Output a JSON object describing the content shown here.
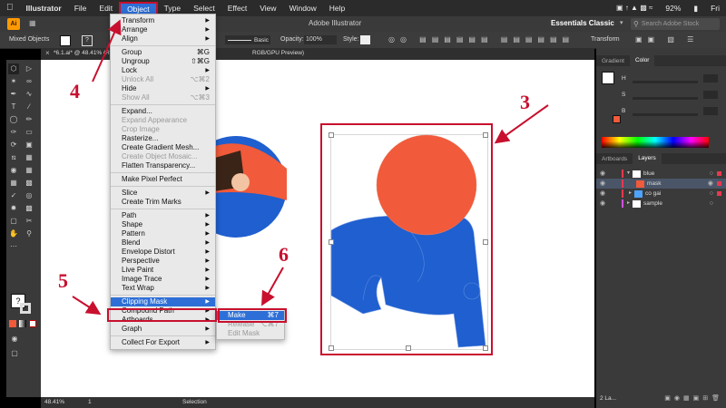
{
  "menubar": {
    "app_name": "Illustrator",
    "items": [
      "File",
      "Edit",
      "Object",
      "Type",
      "Select",
      "Effect",
      "View",
      "Window",
      "Help"
    ],
    "active_item": "Object",
    "battery": "92%",
    "day": "Fri"
  },
  "appbar": {
    "title": "Adobe Illustrator",
    "workspace": "Essentials Classic",
    "search_placeholder": "Search Adobe Stock"
  },
  "control_bar": {
    "selection_label": "Mixed Objects",
    "stroke_style": "Basic",
    "opacity_label": "Opacity:",
    "opacity_value": "100%",
    "style_label": "Style:",
    "transform_label": "Transform"
  },
  "document_tab": {
    "title": "*6.1.ai* @ 48.41% (RGB",
    "title_tail": "RGB/GPU Preview)"
  },
  "status_bar": {
    "zoom": "48.41%",
    "page": "1",
    "tool": "Selection"
  },
  "object_menu": {
    "groups": [
      [
        {
          "label": "Transform",
          "sub": true
        },
        {
          "label": "Arrange",
          "sub": true
        },
        {
          "label": "Align",
          "sub": true
        }
      ],
      [
        {
          "label": "Group",
          "shortcut": "⌘G"
        },
        {
          "label": "Ungroup",
          "shortcut": "⇧⌘G"
        },
        {
          "label": "Lock",
          "sub": true
        },
        {
          "label": "Unlock All",
          "shortcut": "⌥⌘2",
          "disabled": true
        },
        {
          "label": "Hide",
          "sub": true
        },
        {
          "label": "Show All",
          "shortcut": "⌥⌘3",
          "disabled": true
        }
      ],
      [
        {
          "label": "Expand..."
        },
        {
          "label": "Expand Appearance",
          "disabled": true
        },
        {
          "label": "Crop Image",
          "disabled": true
        },
        {
          "label": "Rasterize..."
        },
        {
          "label": "Create Gradient Mesh..."
        },
        {
          "label": "Create Object Mosaic...",
          "disabled": true
        },
        {
          "label": "Flatten Transparency..."
        }
      ],
      [
        {
          "label": "Make Pixel Perfect"
        }
      ],
      [
        {
          "label": "Slice",
          "sub": true
        },
        {
          "label": "Create Trim Marks"
        }
      ],
      [
        {
          "label": "Path",
          "sub": true
        },
        {
          "label": "Shape",
          "sub": true
        },
        {
          "label": "Pattern",
          "sub": true
        },
        {
          "label": "Blend",
          "sub": true
        },
        {
          "label": "Envelope Distort",
          "sub": true
        },
        {
          "label": "Perspective",
          "sub": true
        },
        {
          "label": "Live Paint",
          "sub": true
        },
        {
          "label": "Image Trace",
          "sub": true
        },
        {
          "label": "Text Wrap",
          "sub": true
        }
      ],
      [
        {
          "label": "Clipping Mask",
          "sub": true,
          "highlight": true
        },
        {
          "label": "Compound Path",
          "sub": true
        },
        {
          "label": "Artboards",
          "sub": true
        },
        {
          "label": "Graph",
          "sub": true
        }
      ],
      [
        {
          "label": "Collect For Export",
          "sub": true
        }
      ]
    ]
  },
  "clipping_submenu": [
    {
      "label": "Make",
      "shortcut": "⌘7",
      "highlight": true
    },
    {
      "label": "Release",
      "shortcut": "⌥⌘7",
      "disabled": true
    },
    {
      "label": "Edit Mask",
      "disabled": true
    }
  ],
  "annotations": [
    "4",
    "3",
    "5",
    "6"
  ],
  "color_panel": {
    "tabs": [
      "Gradient",
      "Color"
    ],
    "channels": [
      "H",
      "S",
      "B"
    ]
  },
  "layers_panel": {
    "tabs": [
      "Artboards",
      "Layers"
    ],
    "layers": [
      {
        "name": "blue",
        "level": 0,
        "color": "#e8394f"
      },
      {
        "name": "mask",
        "level": 1,
        "color": "#f15a3a"
      },
      {
        "name": "co gai",
        "level": 1,
        "color": "#4da3ff"
      },
      {
        "name": "sample",
        "level": 0,
        "color": "#d050e0"
      }
    ],
    "footer": "2 La..."
  },
  "colors": {
    "orange": "#f15a3a",
    "blue": "#1f5fcf",
    "annotation_red": "#c8102e",
    "menu_highlight": "#2d6fd6"
  }
}
